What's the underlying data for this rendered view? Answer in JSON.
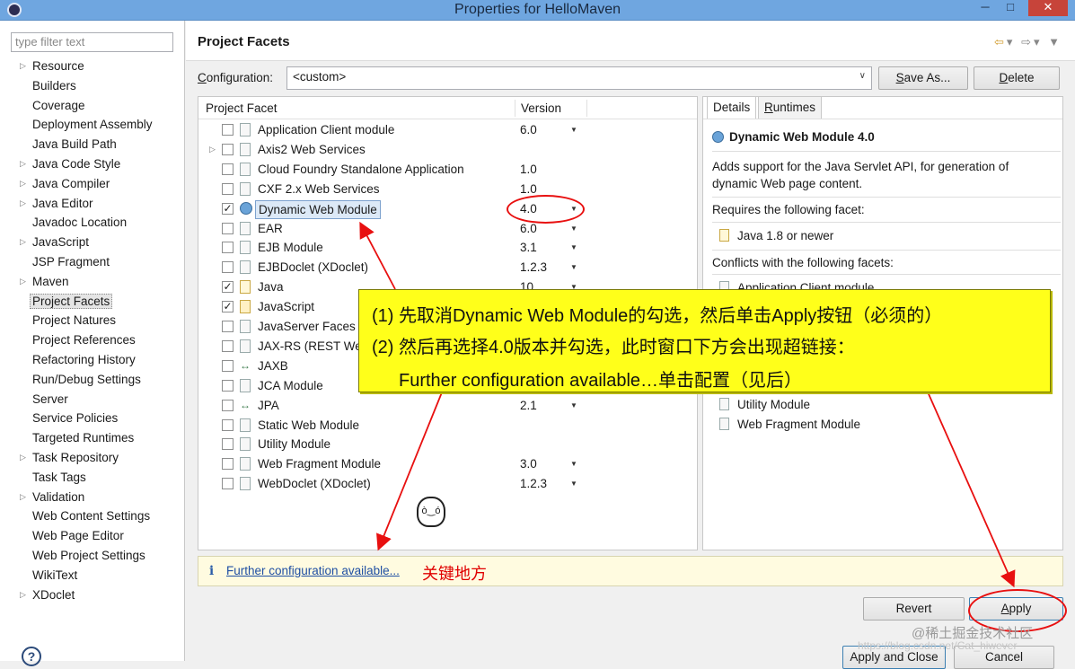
{
  "window": {
    "title": "Properties for HelloMaven",
    "minimize": "─",
    "maximize": "□",
    "close": "✕"
  },
  "sidebar": {
    "filter_placeholder": "type filter text",
    "items": [
      {
        "label": "Resource",
        "expandable": true
      },
      {
        "label": "Builders",
        "expandable": false
      },
      {
        "label": "Coverage",
        "expandable": false
      },
      {
        "label": "Deployment Assembly",
        "expandable": false
      },
      {
        "label": "Java Build Path",
        "expandable": false
      },
      {
        "label": "Java Code Style",
        "expandable": true
      },
      {
        "label": "Java Compiler",
        "expandable": true
      },
      {
        "label": "Java Editor",
        "expandable": true
      },
      {
        "label": "Javadoc Location",
        "expandable": false
      },
      {
        "label": "JavaScript",
        "expandable": true
      },
      {
        "label": "JSP Fragment",
        "expandable": false
      },
      {
        "label": "Maven",
        "expandable": true
      },
      {
        "label": "Project Facets",
        "expandable": false,
        "selected": true
      },
      {
        "label": "Project Natures",
        "expandable": false
      },
      {
        "label": "Project References",
        "expandable": false
      },
      {
        "label": "Refactoring History",
        "expandable": false
      },
      {
        "label": "Run/Debug Settings",
        "expandable": false
      },
      {
        "label": "Server",
        "expandable": false
      },
      {
        "label": "Service Policies",
        "expandable": false
      },
      {
        "label": "Targeted Runtimes",
        "expandable": false
      },
      {
        "label": "Task Repository",
        "expandable": true
      },
      {
        "label": "Task Tags",
        "expandable": false
      },
      {
        "label": "Validation",
        "expandable": true
      },
      {
        "label": "Web Content Settings",
        "expandable": false
      },
      {
        "label": "Web Page Editor",
        "expandable": false
      },
      {
        "label": "Web Project Settings",
        "expandable": false
      },
      {
        "label": "WikiText",
        "expandable": false
      },
      {
        "label": "XDoclet",
        "expandable": true
      }
    ],
    "help": "?"
  },
  "header": {
    "title": "Project Facets",
    "back_icon": "back-arrow-icon",
    "forward_icon": "forward-arrow-icon"
  },
  "configuration": {
    "label_prefix": "C",
    "label_rest": "onfiguration:",
    "value": "<custom>",
    "save_as_prefix": "S",
    "save_as_rest": "ave As...",
    "delete_prefix": "D",
    "delete_rest": "elete"
  },
  "facets": {
    "col_facet": "Project Facet",
    "col_version": "Version",
    "rows": [
      {
        "name": "Application Client module",
        "version": "6.0",
        "checked": false,
        "dropdown": true,
        "expandable": false,
        "icon": "doc"
      },
      {
        "name": "Axis2 Web Services",
        "version": "",
        "checked": false,
        "dropdown": false,
        "expandable": true,
        "icon": "doc"
      },
      {
        "name": "Cloud Foundry Standalone Application",
        "version": "1.0",
        "checked": false,
        "dropdown": false,
        "expandable": false,
        "icon": "doc"
      },
      {
        "name": "CXF 2.x Web Services",
        "version": "1.0",
        "checked": false,
        "dropdown": false,
        "expandable": false,
        "icon": "doc"
      },
      {
        "name": "Dynamic Web Module",
        "version": "4.0",
        "checked": true,
        "dropdown": true,
        "expandable": false,
        "icon": "globe",
        "selected": true
      },
      {
        "name": "EAR",
        "version": "6.0",
        "checked": false,
        "dropdown": true,
        "expandable": false,
        "icon": "doc"
      },
      {
        "name": "EJB Module",
        "version": "3.1",
        "checked": false,
        "dropdown": true,
        "expandable": false,
        "icon": "doc"
      },
      {
        "name": "EJBDoclet (XDoclet)",
        "version": "1.2.3",
        "checked": false,
        "dropdown": true,
        "expandable": false,
        "icon": "doc"
      },
      {
        "name": "Java",
        "version": "10",
        "checked": true,
        "dropdown": true,
        "expandable": false,
        "icon": "java"
      },
      {
        "name": "JavaScript",
        "version": "",
        "checked": true,
        "dropdown": false,
        "expandable": false,
        "icon": "js"
      },
      {
        "name": "JavaServer Faces",
        "version": "",
        "checked": false,
        "dropdown": false,
        "expandable": false,
        "icon": "doc"
      },
      {
        "name": "JAX-RS (REST We",
        "version": "",
        "checked": false,
        "dropdown": false,
        "expandable": false,
        "icon": "doc"
      },
      {
        "name": "JAXB",
        "version": "",
        "checked": false,
        "dropdown": false,
        "expandable": false,
        "icon": "arr"
      },
      {
        "name": "JCA Module",
        "version": "",
        "checked": false,
        "dropdown": false,
        "expandable": false,
        "icon": "doc"
      },
      {
        "name": "JPA",
        "version": "2.1",
        "checked": false,
        "dropdown": true,
        "expandable": false,
        "icon": "arr"
      },
      {
        "name": "Static Web Module",
        "version": "",
        "checked": false,
        "dropdown": false,
        "expandable": false,
        "icon": "doc"
      },
      {
        "name": "Utility Module",
        "version": "",
        "checked": false,
        "dropdown": false,
        "expandable": false,
        "icon": "doc"
      },
      {
        "name": "Web Fragment Module",
        "version": "3.0",
        "checked": false,
        "dropdown": true,
        "expandable": false,
        "icon": "doc"
      },
      {
        "name": "WebDoclet (XDoclet)",
        "version": "1.2.3",
        "checked": false,
        "dropdown": true,
        "expandable": false,
        "icon": "doc"
      }
    ]
  },
  "details": {
    "tab_details": "Details",
    "tab_runtimes_prefix": "R",
    "tab_runtimes_rest": "untimes",
    "title": "Dynamic Web Module 4.0",
    "description": "Adds support for the Java Servlet API, for generation of dynamic Web page content.",
    "requires_label": "Requires the following facet:",
    "requires": [
      "Java 1.8 or newer"
    ],
    "conflicts_label": "Conflicts with the following facets:",
    "conflicts": [
      "Application Client module",
      "Utility Module",
      "Web Fragment Module"
    ]
  },
  "info_bar": {
    "icon": "i",
    "link": "Further configuration available...",
    "annotation": "关键地方"
  },
  "buttons": {
    "revert": "Revert",
    "apply_prefix": "A",
    "apply_rest": "pply",
    "apply_close": "Apply and Close",
    "cancel": "Cancel"
  },
  "callout": {
    "line1": "(1) 先取消Dynamic Web Module的勾选，然后单击Apply按钮（必须的）",
    "line2": "(2) 然后再选择4.0版本并勾选，此时窗口下方会出现超链接：",
    "line3": "Further configuration available…单击配置（见后）"
  },
  "watermark": {
    "text": "@稀土掘金技术社区",
    "url": "https://blog.csdn.net/Cat_hiwever"
  },
  "colors": {
    "annotation_red": "#e81010",
    "callout_yellow": "#ffff1a",
    "titlebar_blue": "#6fa6e0",
    "link_blue": "#1f4fa3"
  }
}
